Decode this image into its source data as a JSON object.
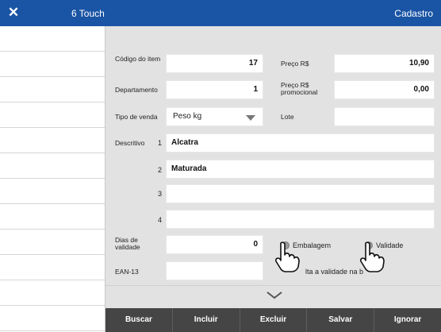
{
  "titlebar": {
    "app_title": "6 Touch",
    "section": "Cadastro",
    "close_icon": "close-icon"
  },
  "form": {
    "codigo": {
      "label": "Código do item",
      "value": "17"
    },
    "preco": {
      "label": "Preço R$",
      "value": "10,90"
    },
    "departamento": {
      "label": "Departamento",
      "value": "1"
    },
    "preco_promocional": {
      "label": "Preço R$ promocional",
      "value": "0,00"
    },
    "tipo_venda": {
      "label": "Tipo de venda",
      "value": "Peso kg"
    },
    "lote": {
      "label": "Lote",
      "value": ""
    },
    "descritivo": {
      "label": "Descritivo",
      "lines": [
        {
          "index": "1",
          "value": "Alcatra"
        },
        {
          "index": "2",
          "value": "Maturada"
        },
        {
          "index": "3",
          "value": ""
        },
        {
          "index": "4",
          "value": ""
        }
      ]
    },
    "dias_validade": {
      "label": "Dias de validade",
      "value": "0"
    },
    "embalagem": {
      "label": "Embalagem"
    },
    "validade": {
      "label": "Validade"
    },
    "ean": {
      "label": "EAN-13",
      "value": ""
    },
    "hint_text": "lta a validade na b"
  },
  "toolbar": {
    "buscar": "Buscar",
    "incluir": "Incluir",
    "excluir": "Excluir",
    "salvar": "Salvar",
    "ignorar": "Ignorar"
  }
}
